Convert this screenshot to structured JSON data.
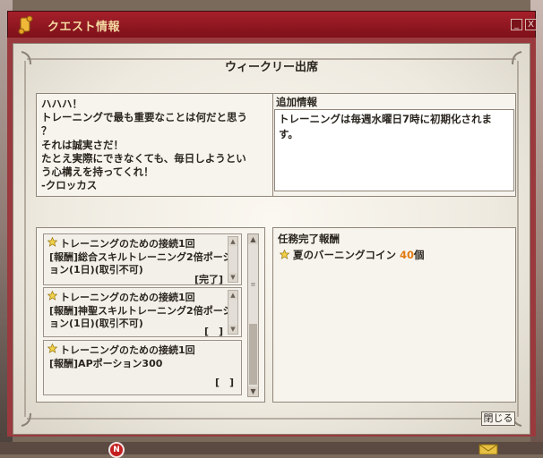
{
  "window": {
    "title": "クエスト情報",
    "minimize_label": "_",
    "close_label": "X"
  },
  "header": {
    "title": "ウィークリー出席"
  },
  "message": {
    "text": "ハハハ！\nトレーニングで最も重要なことは何だと思う\n？\nそれは誠実さだ！\nたとえ実際にできなくても、毎日しようとい\nう心構えを持ってくれ！\n-クロッカス"
  },
  "additional_info": {
    "title": "追加情報",
    "text": "トレーニングは毎週水曜日7時に初期化されます。"
  },
  "quests": [
    {
      "name": "トレーニングのための接続1回",
      "reward": "[報酬]総合スキルトレーニング2倍ポーション(1日)(取引不可)",
      "status": "[完了]"
    },
    {
      "name": "トレーニングのための接続1回",
      "reward": "[報酬]神聖スキルトレーニング2倍ポーション(1日)(取引不可)",
      "status": "[　]"
    },
    {
      "name": "トレーニングのための接続1回",
      "reward": "[報酬]APポーション300",
      "status": "[　]"
    }
  ],
  "completion_reward": {
    "title": "任務完了報酬",
    "item_name": "夏のバーニングコイン",
    "quantity": "40",
    "unit": "個"
  },
  "buttons": {
    "close_label": "閉じる"
  },
  "badge": {
    "label": "N"
  },
  "colors": {
    "titlebar": "#a5202a",
    "title_text": "#f4d9a2",
    "quantity": "#e07a10"
  }
}
